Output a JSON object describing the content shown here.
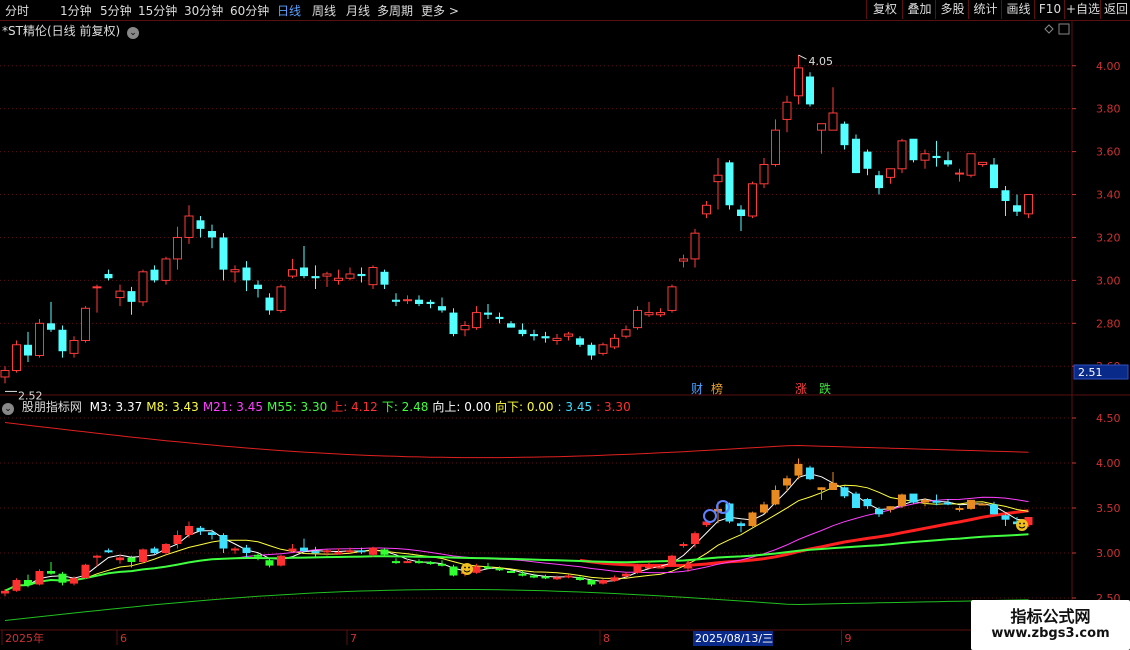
{
  "toolbar": {
    "periods": [
      "分时",
      "1分钟",
      "5分钟",
      "15分钟",
      "30分钟",
      "60分钟",
      "日线",
      "周线",
      "月线",
      "多周期",
      "更多 >"
    ],
    "active_period": "日线",
    "right_buttons": [
      "复权",
      "叠加",
      "多股",
      "统计",
      "画线",
      "F10",
      "+自选",
      "返回"
    ]
  },
  "main": {
    "title": "*ST精伦(日线 前复权)",
    "high_label": "4.05",
    "low_label": "2.52",
    "price_box": "2.51",
    "event_tags": [
      {
        "text": "财",
        "color": "#4aa0ff"
      },
      {
        "text": "榜",
        "color": "#e8a030"
      },
      {
        "text": "涨",
        "color": "#ff4040"
      },
      {
        "text": "跌",
        "color": "#40e040"
      }
    ],
    "y_ticks": [
      "4.00",
      "3.80",
      "3.60",
      "3.40",
      "3.20",
      "3.00",
      "2.80",
      "2.60"
    ],
    "y_range": [
      2.48,
      4.12
    ]
  },
  "indicator": {
    "name": "股朋指标网",
    "values": [
      {
        "label": "M3: 3.37",
        "color": "#ffffff"
      },
      {
        "label": "M8: 3.43",
        "color": "#ffff40"
      },
      {
        "label": "M21: 3.45",
        "color": "#ff40ff"
      },
      {
        "label": "M55: 3.30",
        "color": "#40ff40"
      },
      {
        "label": "上: 4.12",
        "color": "#ff3030"
      },
      {
        "label": "下: 2.48",
        "color": "#40ff40"
      },
      {
        "label": "向上: 0.00",
        "color": "#ffffff"
      },
      {
        "label": "向下: 0.00",
        "color": "#ffff40"
      },
      {
        "label": ": 3.45",
        "color": "#40e0ff"
      },
      {
        "label": ": 3.30",
        "color": "#ff3030"
      }
    ],
    "y_ticks": [
      "4.50",
      "4.00",
      "3.50",
      "3.00",
      "2.50"
    ],
    "y_range": [
      2.2,
      4.7
    ]
  },
  "x_axis": {
    "labels": [
      {
        "text": "2025年",
        "idx": 0
      },
      {
        "text": "6",
        "idx": 10
      },
      {
        "text": "7",
        "idx": 30
      },
      {
        "text": "8",
        "idx": 52
      },
      {
        "text": "2025/08/13/三",
        "idx": 60,
        "highlight": true
      },
      {
        "text": "9",
        "idx": 73
      }
    ]
  },
  "watermark": {
    "line1": "指标公式网",
    "line2": "www.zbgs3.com"
  },
  "colors": {
    "up": "#ff3c3c",
    "down": "#54ffff",
    "grid": "#5a1010",
    "axis_text": "#cc3333"
  },
  "chart_data": {
    "type": "candlestick",
    "ohlc": [
      [
        2.55,
        2.6,
        2.52,
        2.58
      ],
      [
        2.58,
        2.72,
        2.57,
        2.7
      ],
      [
        2.7,
        2.76,
        2.62,
        2.65
      ],
      [
        2.65,
        2.82,
        2.64,
        2.8
      ],
      [
        2.8,
        2.9,
        2.76,
        2.77
      ],
      [
        2.77,
        2.79,
        2.64,
        2.67
      ],
      [
        2.66,
        2.74,
        2.64,
        2.72
      ],
      [
        2.72,
        2.88,
        2.71,
        2.87
      ],
      [
        2.97,
        2.98,
        2.85,
        2.97
      ],
      [
        3.03,
        3.05,
        3.0,
        3.01
      ],
      [
        2.92,
        2.98,
        2.88,
        2.95
      ],
      [
        2.95,
        2.97,
        2.84,
        2.9
      ],
      [
        2.9,
        3.05,
        2.88,
        3.04
      ],
      [
        3.05,
        3.07,
        2.99,
        3.0
      ],
      [
        3.0,
        3.11,
        2.98,
        3.1
      ],
      [
        3.1,
        3.25,
        3.05,
        3.2
      ],
      [
        3.2,
        3.35,
        3.17,
        3.3
      ],
      [
        3.28,
        3.3,
        3.2,
        3.24
      ],
      [
        3.23,
        3.26,
        3.15,
        3.2
      ],
      [
        3.2,
        3.22,
        3.0,
        3.05
      ],
      [
        3.04,
        3.07,
        2.99,
        3.05
      ],
      [
        3.06,
        3.09,
        2.95,
        3.0
      ],
      [
        2.98,
        3.0,
        2.92,
        2.96
      ],
      [
        2.92,
        2.94,
        2.84,
        2.86
      ],
      [
        2.86,
        2.98,
        2.85,
        2.97
      ],
      [
        3.02,
        3.1,
        3.01,
        3.05
      ],
      [
        3.06,
        3.16,
        3.01,
        3.02
      ],
      [
        3.02,
        3.07,
        2.96,
        3.01
      ],
      [
        3.02,
        3.04,
        2.97,
        3.03
      ],
      [
        3.0,
        3.05,
        2.98,
        3.01
      ],
      [
        3.01,
        3.06,
        3.0,
        3.03
      ],
      [
        3.03,
        3.06,
        2.99,
        3.02
      ],
      [
        2.98,
        3.07,
        2.96,
        3.06
      ],
      [
        3.04,
        3.05,
        2.96,
        2.98
      ],
      [
        2.91,
        2.94,
        2.88,
        2.9
      ],
      [
        2.91,
        2.93,
        2.89,
        2.91
      ],
      [
        2.91,
        2.93,
        2.88,
        2.89
      ],
      [
        2.9,
        2.91,
        2.87,
        2.89
      ],
      [
        2.88,
        2.92,
        2.85,
        2.86
      ],
      [
        2.85,
        2.87,
        2.74,
        2.75
      ],
      [
        2.77,
        2.81,
        2.74,
        2.79
      ],
      [
        2.78,
        2.88,
        2.77,
        2.85
      ],
      [
        2.85,
        2.89,
        2.82,
        2.84
      ],
      [
        2.83,
        2.85,
        2.8,
        2.82
      ],
      [
        2.8,
        2.81,
        2.78,
        2.78
      ],
      [
        2.77,
        2.8,
        2.74,
        2.75
      ],
      [
        2.75,
        2.77,
        2.72,
        2.74
      ],
      [
        2.74,
        2.76,
        2.71,
        2.73
      ],
      [
        2.72,
        2.75,
        2.7,
        2.73
      ],
      [
        2.74,
        2.76,
        2.72,
        2.75
      ],
      [
        2.73,
        2.74,
        2.69,
        2.7
      ],
      [
        2.7,
        2.71,
        2.63,
        2.65
      ],
      [
        2.66,
        2.71,
        2.65,
        2.7
      ],
      [
        2.69,
        2.75,
        2.68,
        2.73
      ],
      [
        2.74,
        2.79,
        2.73,
        2.77
      ],
      [
        2.78,
        2.88,
        2.77,
        2.86
      ],
      [
        2.84,
        2.9,
        2.83,
        2.85
      ],
      [
        2.84,
        2.87,
        2.83,
        2.85
      ],
      [
        2.86,
        2.98,
        2.85,
        2.97
      ],
      [
        3.09,
        3.12,
        3.06,
        3.1
      ],
      [
        3.1,
        3.24,
        3.06,
        3.22
      ],
      [
        3.31,
        3.37,
        3.29,
        3.35
      ],
      [
        3.46,
        3.57,
        3.33,
        3.49
      ],
      [
        3.55,
        3.56,
        3.33,
        3.35
      ],
      [
        3.33,
        3.35,
        3.23,
        3.3
      ],
      [
        3.3,
        3.46,
        3.29,
        3.45
      ],
      [
        3.45,
        3.57,
        3.43,
        3.54
      ],
      [
        3.54,
        3.75,
        3.53,
        3.7
      ],
      [
        3.75,
        3.86,
        3.69,
        3.83
      ],
      [
        3.86,
        4.05,
        3.82,
        3.99
      ],
      [
        3.95,
        3.97,
        3.81,
        3.82
      ],
      [
        3.7,
        3.73,
        3.59,
        3.73
      ],
      [
        3.7,
        3.9,
        3.7,
        3.78
      ],
      [
        3.73,
        3.74,
        3.61,
        3.63
      ],
      [
        3.66,
        3.68,
        3.5,
        3.5
      ],
      [
        3.6,
        3.61,
        3.49,
        3.52
      ],
      [
        3.49,
        3.51,
        3.4,
        3.43
      ],
      [
        3.48,
        3.52,
        3.45,
        3.52
      ],
      [
        3.52,
        3.66,
        3.5,
        3.65
      ],
      [
        3.66,
        3.64,
        3.55,
        3.56
      ],
      [
        3.56,
        3.61,
        3.52,
        3.59
      ],
      [
        3.58,
        3.65,
        3.53,
        3.57
      ],
      [
        3.56,
        3.6,
        3.53,
        3.54
      ],
      [
        3.5,
        3.52,
        3.46,
        3.5
      ],
      [
        3.49,
        3.59,
        3.48,
        3.59
      ],
      [
        3.54,
        3.55,
        3.53,
        3.55
      ],
      [
        3.54,
        3.57,
        3.43,
        3.43
      ],
      [
        3.42,
        3.44,
        3.3,
        3.37
      ],
      [
        3.35,
        3.4,
        3.3,
        3.32
      ],
      [
        3.31,
        3.4,
        3.29,
        3.4
      ]
    ],
    "bands": {
      "upper_start": 4.45,
      "upper_end": 4.12,
      "lower_start": 2.25,
      "lower_end": 2.48
    },
    "last_values": {
      "M3": 3.37,
      "M8": 3.43,
      "M21": 3.45,
      "M55": 3.3
    }
  }
}
